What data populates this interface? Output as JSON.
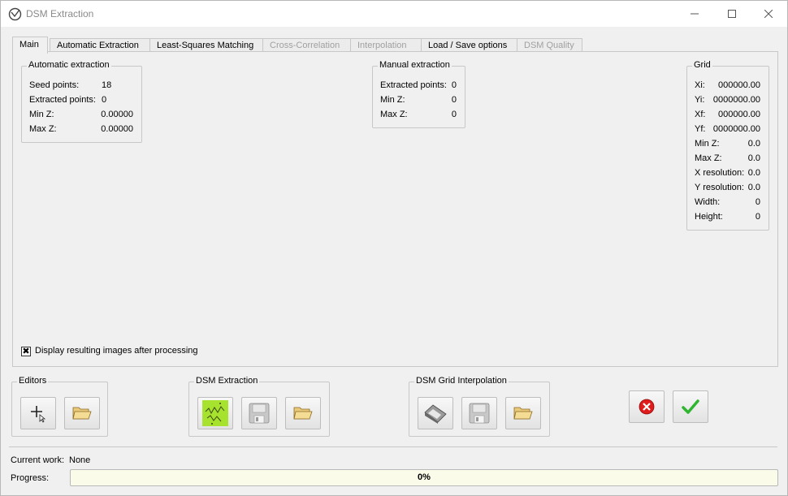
{
  "window": {
    "title": "DSM Extraction"
  },
  "tabs": [
    {
      "label": "Main",
      "state": "active"
    },
    {
      "label": "Automatic Extraction",
      "state": "normal"
    },
    {
      "label": "Least-Squares Matching",
      "state": "normal"
    },
    {
      "label": "Cross-Correlation",
      "state": "disabled"
    },
    {
      "label": "Interpolation",
      "state": "disabled"
    },
    {
      "label": "Load / Save options",
      "state": "normal"
    },
    {
      "label": "DSM Quality",
      "state": "disabled"
    }
  ],
  "automatic": {
    "title": "Automatic extraction",
    "rows": [
      {
        "label": "Seed points:",
        "value": "18"
      },
      {
        "label": "Extracted points:",
        "value": "0"
      },
      {
        "label": "Min Z:",
        "value": "0.00000"
      },
      {
        "label": "Max Z:",
        "value": "0.00000"
      }
    ]
  },
  "manual": {
    "title": "Manual extraction",
    "rows": [
      {
        "label": "Extracted points:",
        "value": "0"
      },
      {
        "label": "Min Z:",
        "value": "0"
      },
      {
        "label": "Max Z:",
        "value": "0"
      }
    ]
  },
  "grid": {
    "title": "Grid",
    "rows": [
      {
        "label": "Xi:",
        "value": "000000.00"
      },
      {
        "label": "Yi:",
        "value": "0000000.00"
      },
      {
        "label": "Xf:",
        "value": "000000.00"
      },
      {
        "label": "Yf:",
        "value": "0000000.00"
      },
      {
        "label": "Min Z:",
        "value": "0.0"
      },
      {
        "label": "Max Z:",
        "value": "0.0"
      },
      {
        "label": "X resolution:",
        "value": "0.0"
      },
      {
        "label": "Y resolution:",
        "value": "0.0"
      },
      {
        "label": "Width:",
        "value": "0"
      },
      {
        "label": "Height:",
        "value": "0"
      }
    ]
  },
  "display_checkbox": {
    "label": "Display resulting images after processing",
    "checked": true,
    "mark": "✖"
  },
  "groups": {
    "editors": "Editors",
    "extraction": "DSM Extraction",
    "interpolation": "DSM Grid Interpolation"
  },
  "icons": {
    "editors": [
      "add-point-icon",
      "open-folder-icon"
    ],
    "extraction": [
      "dsm-extract-icon",
      "save-disk-icon",
      "open-folder-icon"
    ],
    "interpolation": [
      "grid-interpolate-icon",
      "save-disk-icon",
      "open-folder-icon"
    ],
    "actions": [
      "cancel-icon",
      "ok-checkmark-icon"
    ]
  },
  "status": {
    "current_work_label": "Current work:",
    "current_work_value": "None",
    "progress_label": "Progress:",
    "progress_value": 0,
    "progress_text": "0%"
  },
  "colors": {
    "cancel": "#e01b1b",
    "ok": "#2fb52f",
    "progress_bg": "#fbfbea",
    "extract_icon": "#a6e22e"
  }
}
